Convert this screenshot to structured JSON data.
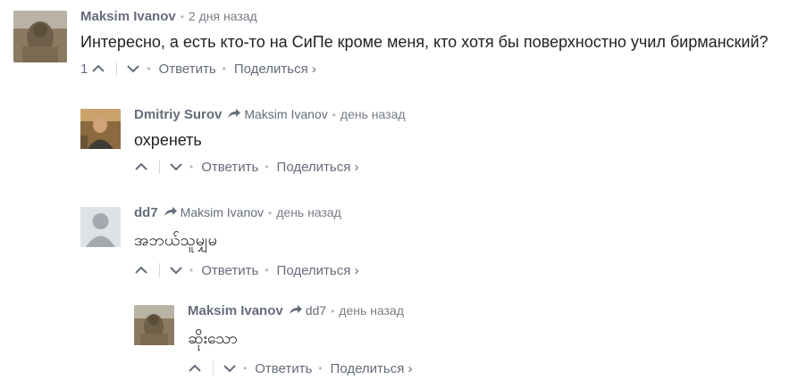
{
  "comments": [
    {
      "author": "Maksim Ivanov",
      "reply_to": "",
      "time": "2 дня назад",
      "text": "Интересно, а есть кто-то на СиПе кроме меня, кто хотя бы поверхностно учил бирманский?",
      "upvotes": "1",
      "reply_label": "Ответить",
      "share_label": "Поделиться ›",
      "avatar": "sculpture-photo"
    },
    {
      "author": "Dmitriy Surov",
      "reply_to": "Maksim Ivanov",
      "time": "день назад",
      "text": "охренеть",
      "upvotes": "",
      "reply_label": "Ответить",
      "share_label": "Поделиться ›",
      "avatar": "person-photo"
    },
    {
      "author": "dd7",
      "reply_to": "Maksim Ivanov",
      "time": "день назад",
      "text": "အဘယ်သူမျှမ",
      "upvotes": "",
      "reply_label": "Ответить",
      "share_label": "Поделиться ›",
      "avatar": "default-user"
    },
    {
      "author": "Maksim Ivanov",
      "reply_to": "dd7",
      "time": "день назад",
      "text": "ဆိုးသော",
      "upvotes": "",
      "reply_label": "Ответить",
      "share_label": "Поделиться ›",
      "avatar": "sculpture-photo"
    }
  ],
  "colors": {
    "meta": "#656c7a",
    "text": "#222222",
    "divider": "#d6d9dc"
  },
  "icons": {
    "reply_arrow": "reply-arrow-icon",
    "upvote": "chevron-up-icon",
    "downvote": "chevron-down-icon"
  }
}
